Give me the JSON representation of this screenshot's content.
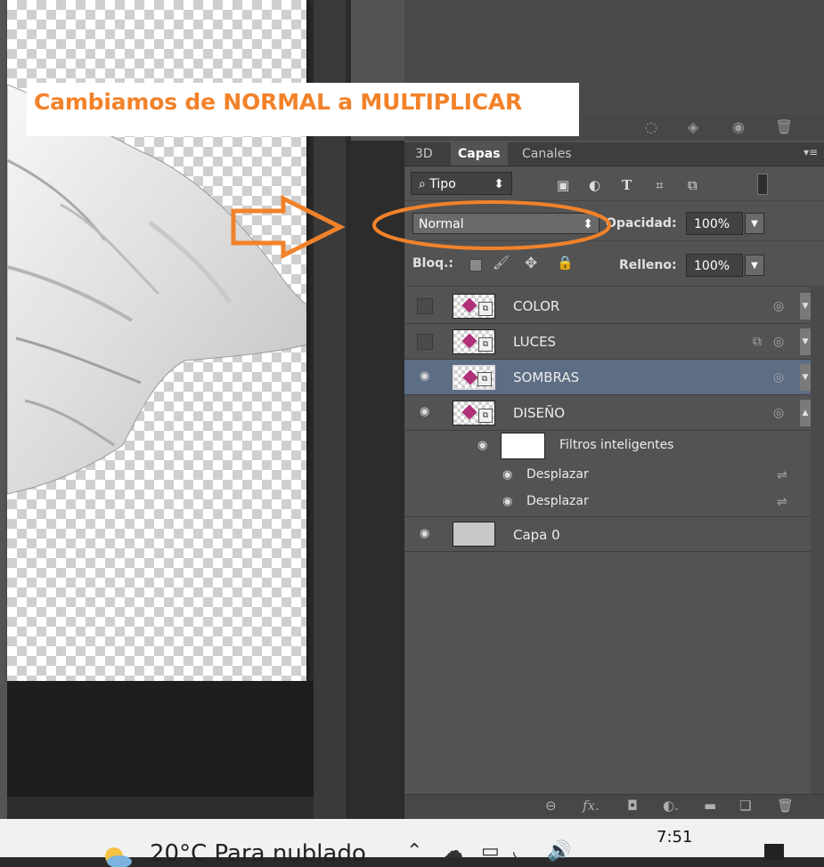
{
  "annotation": {
    "text": "Cambiamos de NORMAL a MULTIPLICAR"
  },
  "panel": {
    "tabs": [
      "3D",
      "Capas",
      "Canales"
    ],
    "filter": {
      "label": "Tipo",
      "search_glyph": "⌕"
    },
    "blend_mode": "Normal",
    "opacity": {
      "label": "Opacidad:",
      "value": "100%"
    },
    "lock": {
      "label": "Bloq.:"
    },
    "fill": {
      "label": "Relleno:",
      "value": "100%"
    }
  },
  "layers": [
    {
      "name": "COLOR",
      "visible": false,
      "selected": false
    },
    {
      "name": "LUCES",
      "visible": false,
      "selected": false
    },
    {
      "name": "SOMBRAS",
      "visible": true,
      "selected": true
    },
    {
      "name": "DISEÑO",
      "visible": true,
      "selected": false
    },
    {
      "name": "Capa 0",
      "visible": true,
      "selected": false
    }
  ],
  "smart_filters": {
    "label": "Filtros inteligentes",
    "items": [
      "Desplazar",
      "Desplazar"
    ]
  },
  "taskbar": {
    "weather": "20°C  Para nublado",
    "time": "7:51"
  },
  "colors": {
    "accent_orange": "#f2822a",
    "selected_layer": "#5c6d84",
    "panel_bg": "#535353"
  },
  "icons": {
    "eye": "👁",
    "lock": "🔒",
    "brush": "🖌",
    "move": "✥"
  }
}
